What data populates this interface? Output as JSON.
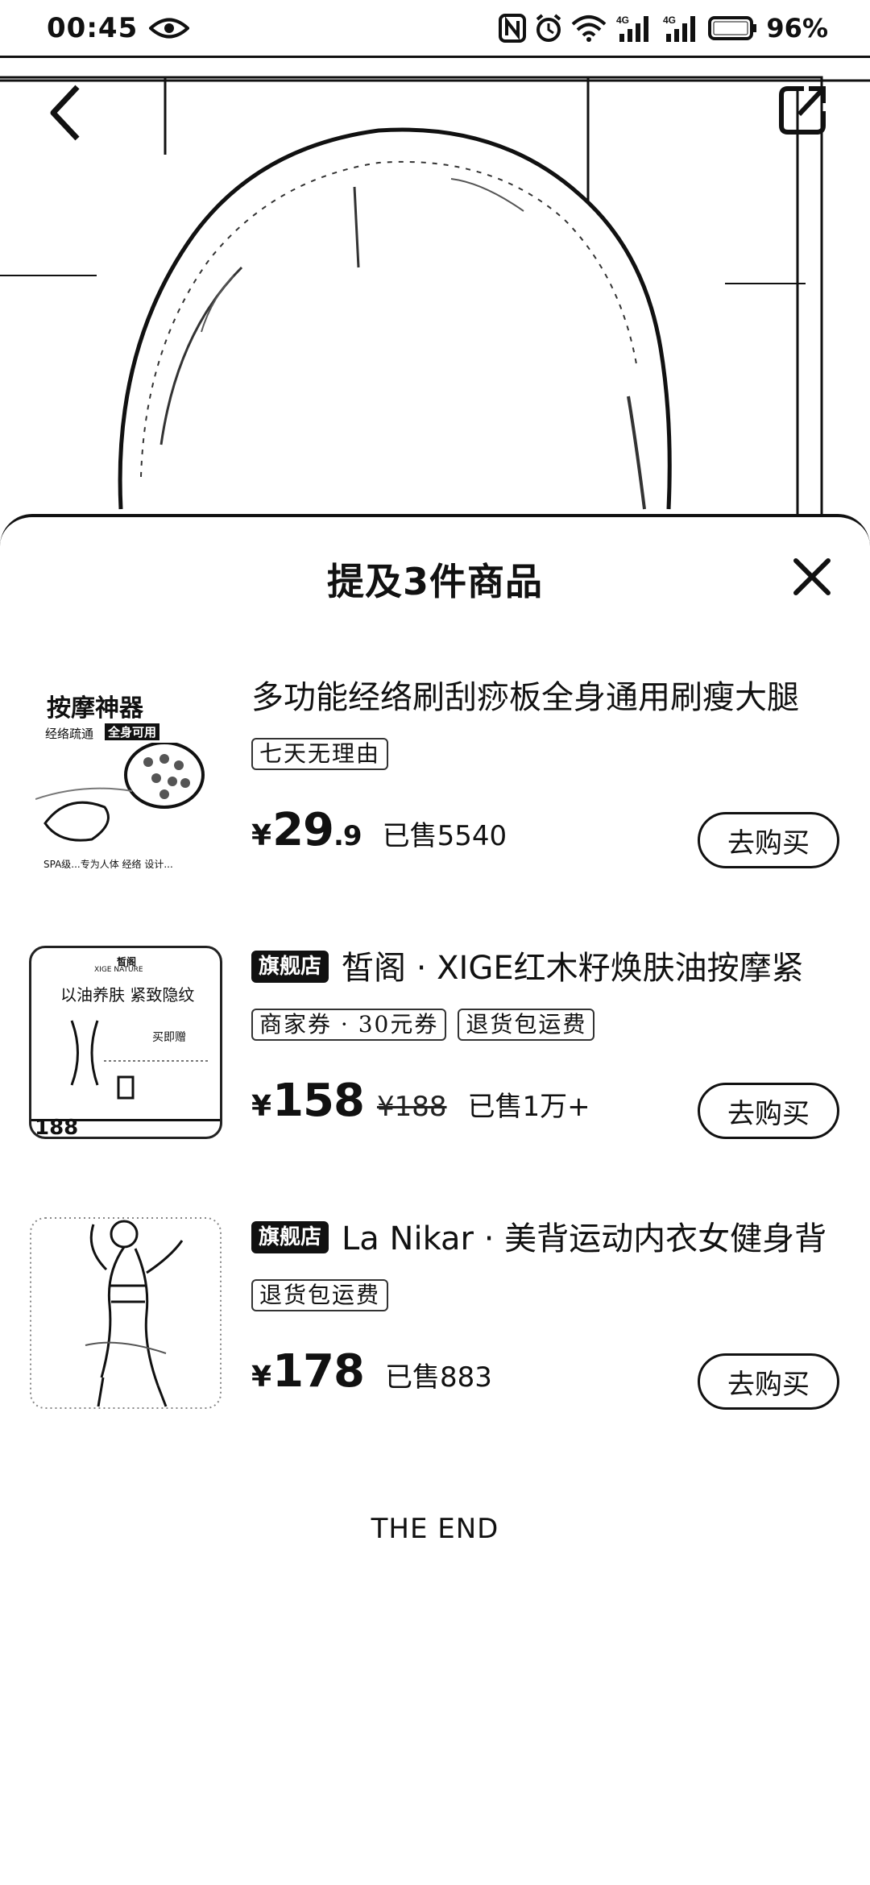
{
  "status_bar": {
    "time": "00:45",
    "battery": "96%",
    "network_badges": [
      "4G",
      "4G"
    ]
  },
  "sheet": {
    "title": "提及3件商品",
    "end_text": "THE END"
  },
  "products": [
    {
      "title": "多功能经络刷刮痧板全身通用刷瘦大腿",
      "store_badge": "",
      "tags": [
        "七天无理由"
      ],
      "price_yen": "¥",
      "price_int": "29",
      "price_dec": ".9",
      "original_price": "",
      "sold": "已售5540",
      "buy_label": "去购买",
      "thumb_lines": [
        "按摩神器",
        "经络疏通",
        "全身可用",
        "SPA级...专为人体 经络 设计..."
      ]
    },
    {
      "title": "皙阁 · XIGE红木籽焕肤油按摩紧",
      "store_badge": "旗舰店",
      "tags": [
        "商家券 · 30元券",
        "退货包运费"
      ],
      "price_yen": "¥",
      "price_int": "158",
      "price_dec": "",
      "original_price": "¥188",
      "sold": "已售1万+",
      "buy_label": "去购买",
      "thumb_lines": [
        "皙阁",
        "XIGE NATURE",
        "以油养肤 紧致隐纹",
        "买即赠",
        "188"
      ]
    },
    {
      "title": "La Nikar · 美背运动内衣女健身背",
      "store_badge": "旗舰店",
      "tags": [
        "退货包运费"
      ],
      "price_yen": "¥",
      "price_int": "178",
      "price_dec": "",
      "original_price": "",
      "sold": "已售883",
      "buy_label": "去购买",
      "thumb_lines": []
    }
  ]
}
